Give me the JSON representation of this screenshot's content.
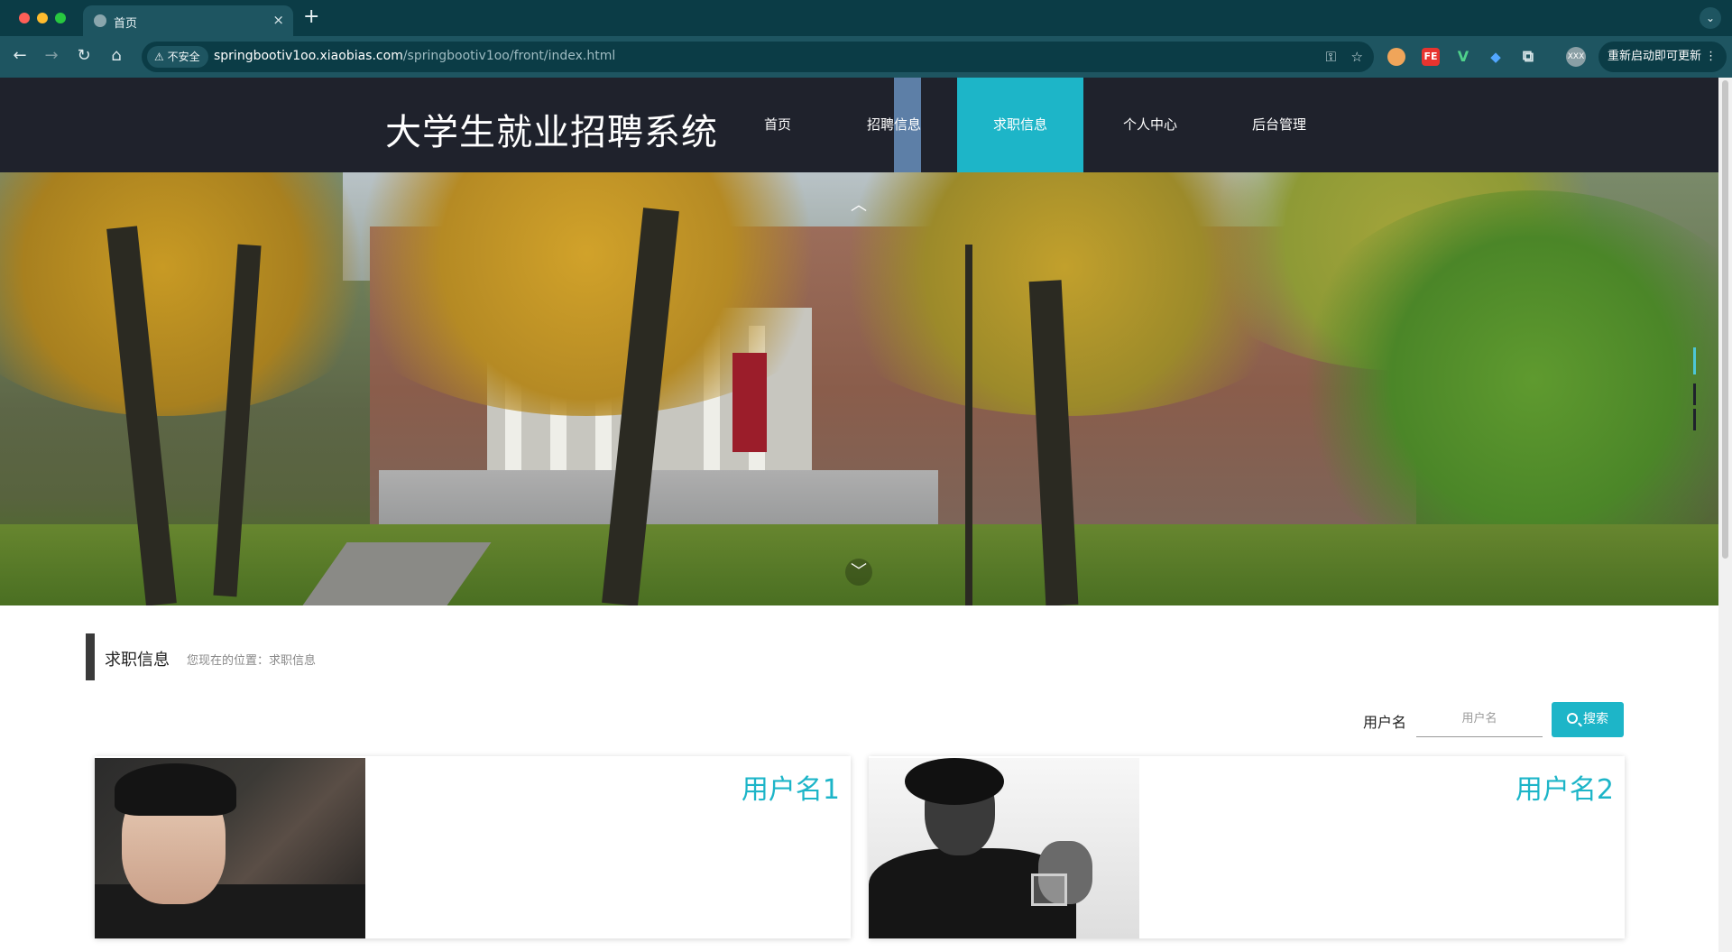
{
  "browser": {
    "tab_title": "首页",
    "close_glyph": "×",
    "new_tab_glyph": "+",
    "tabs_menu_glyph": "⌄",
    "security_label": "⚠ 不安全",
    "url_host": "springbootiv1oo.xiaobias.com",
    "url_path": "/springbootiv1oo/front/index.html",
    "update_button": "重新启动即可更新 ⋮",
    "profile_text": "XXX",
    "icons": {
      "back": "←",
      "forward": "→",
      "reload": "↻",
      "home": "⌂",
      "key": "⚿",
      "star": "☆",
      "ext_fe": "FE",
      "ext_v": "V",
      "ext_gem": "◆",
      "ext_puzzle": "⧉"
    }
  },
  "site": {
    "title": "大学生就业招聘系统",
    "nav": [
      {
        "label": "首页"
      },
      {
        "label": "招聘信息"
      },
      {
        "label": "求职信息",
        "active": true
      },
      {
        "label": "个人中心"
      },
      {
        "label": "后台管理"
      }
    ],
    "active_color": "#1db5c8",
    "header_bg": "#1f222c"
  },
  "banner": {
    "arrow_up": "︿",
    "arrow_down": "﹀",
    "slide_count": 3,
    "active_slide": 1
  },
  "section": {
    "title": "求职信息",
    "breadcrumb": "您现在的位置：求职信息"
  },
  "search": {
    "label": "用户名",
    "placeholder": "用户名",
    "button": "搜索"
  },
  "cards": [
    {
      "name": "用户名1"
    },
    {
      "name": "用户名2"
    }
  ]
}
